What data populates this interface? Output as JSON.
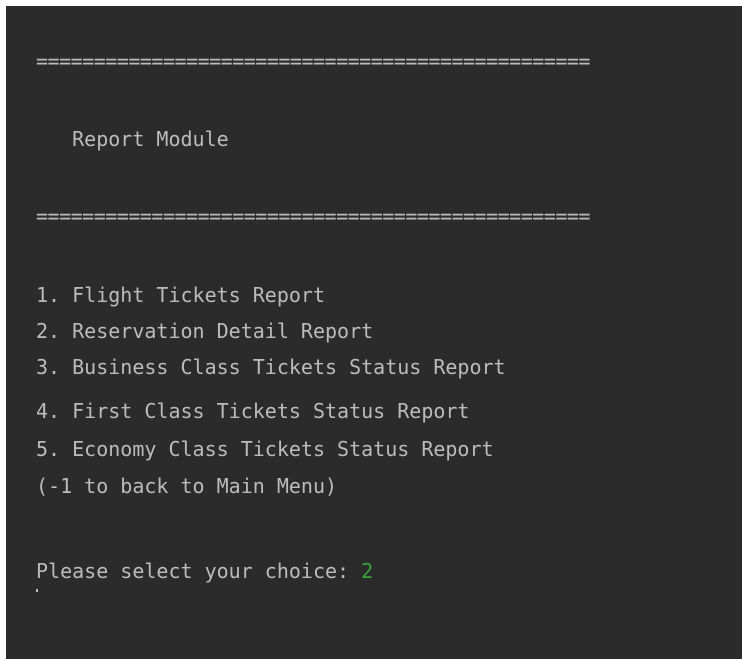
{
  "console": {
    "separator_top": "================================================",
    "title": "   Report Module",
    "separator_bottom": "================================================",
    "menu": [
      "1. Flight Tickets Report",
      "2. Reservation Detail Report",
      "3. Business Class Tickets Status Report",
      "4. First Class Tickets Status Report",
      "5. Economy Class Tickets Status Report"
    ],
    "back_hint": "(-1 to back to Main Menu)",
    "prompt": "Please select your choice: ",
    "input_value": "2",
    "colors": {
      "background": "#2b2b2b",
      "text": "#bbbbbb",
      "input": "#3aa33a"
    }
  }
}
